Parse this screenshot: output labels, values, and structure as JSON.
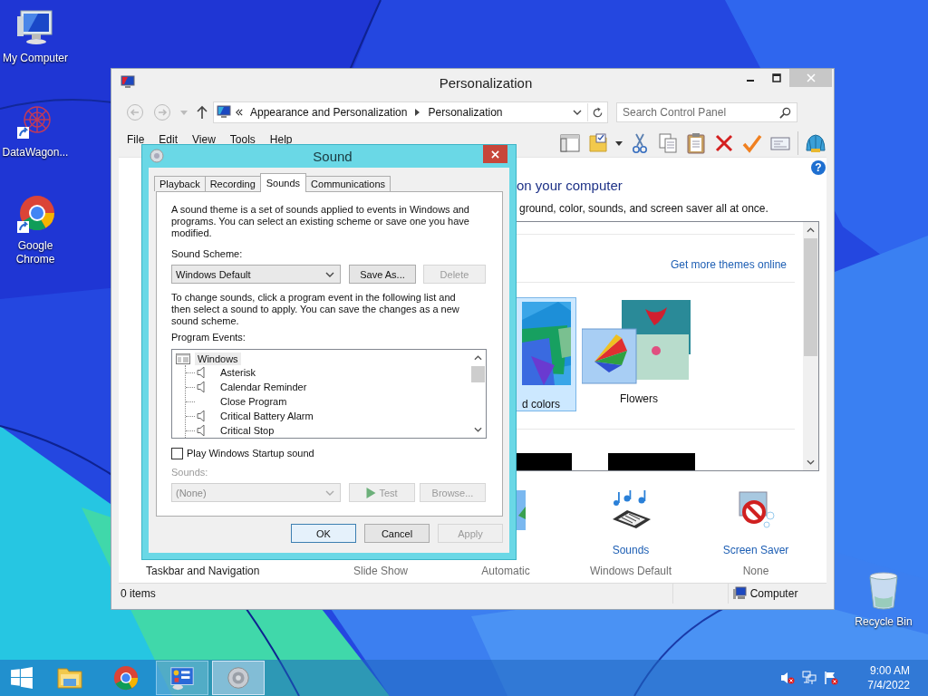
{
  "desktop_icons": [
    {
      "kind": "computer",
      "label": "My Computer"
    },
    {
      "kind": "shortcut",
      "label": "DataWagon..."
    },
    {
      "kind": "chrome",
      "label": "Google Chrome"
    },
    {
      "kind": "bin",
      "label": "Recycle Bin"
    }
  ],
  "personalization": {
    "title": "Personalization",
    "breadcrumb": [
      "Appearance and Personalization",
      "Personalization"
    ],
    "search": {
      "placeholder": "Search Control Panel"
    },
    "menu": [
      "File",
      "Edit",
      "View",
      "Tools",
      "Help"
    ],
    "help_button": "?",
    "heading": "on your computer",
    "description": "ground, color, sounds, and screen saver all at once.",
    "themes_link": "Get more themes online",
    "themes": [
      {
        "kind": "colors",
        "label": "d colors",
        "selected": true
      },
      {
        "kind": "flowers",
        "label": "Flowers",
        "selected": false
      }
    ],
    "settings": [
      {
        "kind": "taskbar",
        "title": "Taskbar and Navigation"
      },
      {
        "kind": "background",
        "subtitle": "Slide Show"
      },
      {
        "kind": "color",
        "subtitle": "Automatic"
      },
      {
        "kind": "sounds",
        "title": "Sounds",
        "subtitle": "Windows Default"
      },
      {
        "kind": "screensaver",
        "title": "Screen Saver",
        "subtitle": "None"
      }
    ],
    "status_bar": {
      "count": "0 items",
      "location": "Computer"
    }
  },
  "sound_dialog": {
    "title": "Sound",
    "tabs": [
      {
        "label": "Playback",
        "selected": false
      },
      {
        "label": "Recording",
        "selected": false
      },
      {
        "label": "Sounds",
        "selected": true
      },
      {
        "label": "Communications",
        "selected": false
      }
    ],
    "intro": "A sound theme is a set of sounds applied to events in Windows and programs.  You can select an existing scheme or save one you have modified.",
    "scheme_label": "Sound Scheme:",
    "scheme": {
      "value": "Windows Default",
      "disabled": false
    },
    "scheme_buttons": [
      {
        "label": "Save As...",
        "disabled": false
      },
      {
        "label": "Delete",
        "disabled": true
      }
    ],
    "instructions": "To change sounds, click a program event in the following list and then select a sound to apply.  You can save the changes as a new sound scheme.",
    "events_label": "Program Events:",
    "events": [
      {
        "label": "Windows",
        "children": [
          {
            "label": "Asterisk",
            "kind": "sound"
          },
          {
            "label": "Calendar Reminder",
            "kind": "sound"
          },
          {
            "label": "Close Program",
            "kind": "silent"
          },
          {
            "label": "Critical Battery Alarm",
            "kind": "sound"
          },
          {
            "label": "Critical Stop",
            "kind": "sound"
          }
        ]
      }
    ],
    "startup": {
      "label": "Play Windows Startup sound",
      "checked": false
    },
    "sounds_label": {
      "text": "Sounds:",
      "disabled": true
    },
    "sound_select": {
      "value": "(None)",
      "disabled": true
    },
    "sound_buttons": [
      {
        "kind": "test",
        "label": "Test",
        "disabled": true
      },
      {
        "kind": "browse",
        "label": "Browse...",
        "disabled": true
      }
    ],
    "buttons": [
      {
        "label": "OK",
        "default": true,
        "disabled": false
      },
      {
        "label": "Cancel",
        "default": false,
        "disabled": false
      },
      {
        "label": "Apply",
        "default": false,
        "disabled": true
      }
    ]
  },
  "taskbar": {
    "apps": [
      {
        "kind": "explorer",
        "active": false,
        "selected": false
      },
      {
        "kind": "chrome",
        "active": false,
        "selected": false
      },
      {
        "kind": "control_panel",
        "active": true,
        "selected": false
      },
      {
        "kind": "sound",
        "active": true,
        "selected": true
      }
    ],
    "tray": [
      {
        "kind": "speaker_muted"
      },
      {
        "kind": "network"
      },
      {
        "kind": "flag"
      }
    ],
    "time": "9:00 AM",
    "date": "7/4/2022"
  }
}
